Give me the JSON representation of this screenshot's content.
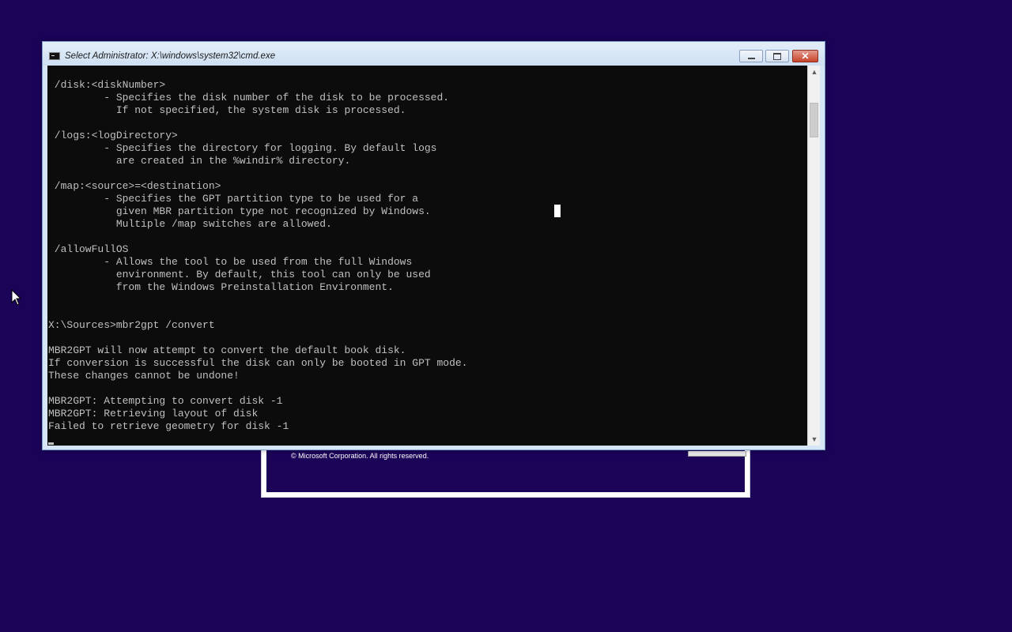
{
  "window": {
    "title": "Select Administrator: X:\\windows\\system32\\cmd.exe",
    "icon": "cmd-icon",
    "buttons": {
      "minimize": "minimize-icon",
      "maximize": "maximize-icon",
      "close": "close-icon"
    }
  },
  "console": {
    "lines": [
      " /disk:<diskNumber>",
      "         - Specifies the disk number of the disk to be processed.",
      "           If not specified, the system disk is processed.",
      "",
      " /logs:<logDirectory>",
      "         - Specifies the directory for logging. By default logs",
      "           are created in the %windir% directory.",
      "",
      " /map:<source>=<destination>",
      "         - Specifies the GPT partition type to be used for a",
      "           given MBR partition type not recognized by Windows.",
      "           Multiple /map switches are allowed.",
      "",
      " /allowFullOS",
      "         - Allows the tool to be used from the full Windows",
      "           environment. By default, this tool can only be used",
      "           from the Windows Preinstallation Environment.",
      "",
      "",
      "X:\\Sources>mbr2gpt /convert",
      "",
      "MBR2GPT will now attempt to convert the default book disk.",
      "If conversion is successful the disk can only be booted in GPT mode.",
      "These changes cannot be undone!",
      "",
      "MBR2GPT: Attempting to convert disk -1",
      "MBR2GPT: Retrieving layout of disk",
      "Failed to retrieve geometry for disk -1"
    ]
  },
  "setup": {
    "copyright": "© Microsoft Corporation. All rights reserved."
  },
  "colors": {
    "desktop": "#1b0358",
    "console_bg": "#0c0c0c",
    "console_fg": "#c0c0c0"
  }
}
